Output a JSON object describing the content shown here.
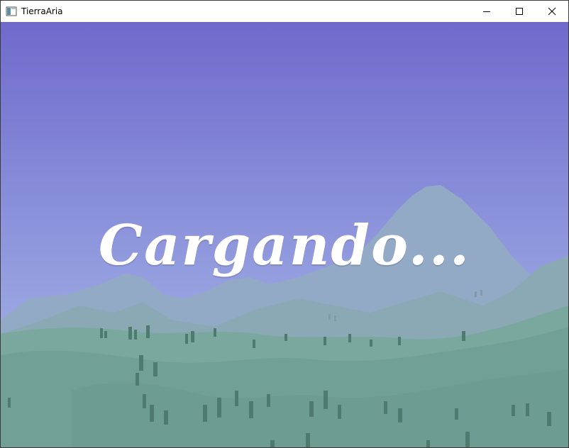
{
  "window": {
    "title": "TierraAria",
    "controls": {
      "minimize": "minimize-icon",
      "maximize": "maximize-icon",
      "close": "close-icon"
    }
  },
  "scene": {
    "loading_text": "Cargando...",
    "colors": {
      "sky_top": "#6f6acc",
      "sky_bottom": "#9aa6e2",
      "mountain_far": "#93aac6",
      "mountain_mid": "#8aa9b4",
      "hills": "#7aa89e",
      "hills_dark": "#6c9a90",
      "trees": "#4f7a70"
    }
  }
}
